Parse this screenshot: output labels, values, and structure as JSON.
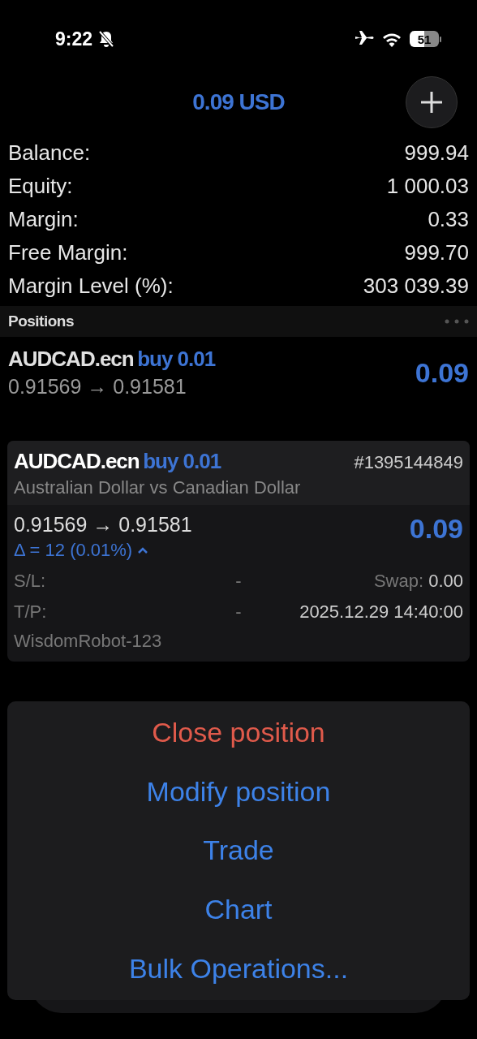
{
  "status_bar": {
    "time": "9:22",
    "battery": "51"
  },
  "header": {
    "title": "0.09 USD"
  },
  "summary": [
    {
      "label": "Balance:",
      "value": "999.94"
    },
    {
      "label": "Equity:",
      "value": "1 000.03"
    },
    {
      "label": "Margin:",
      "value": "0.33"
    },
    {
      "label": "Free Margin:",
      "value": "999.70"
    },
    {
      "label": "Margin Level (%):",
      "value": "303 039.39"
    }
  ],
  "positions": {
    "title": "Positions",
    "items": [
      {
        "symbol": "AUDCAD.ecn",
        "side": "buy 0.01",
        "prices": "0.91569 → 0.91581",
        "profit": "0.09"
      }
    ]
  },
  "detail": {
    "symbol": "AUDCAD.ecn",
    "side": "buy 0.01",
    "ticket": "#1395144849",
    "description": "Australian Dollar vs Canadian Dollar",
    "prices": "0.91569 → 0.91581",
    "profit": "0.09",
    "delta": "Δ = 12 (0.01%)",
    "expanded": true,
    "fields": [
      {
        "left_label": "S/L:",
        "left_value": "-",
        "right_label": "Swap:",
        "right_value": "0.00"
      },
      {
        "left_label": "T/P:",
        "left_value": "-",
        "right_value": "2025.12.29 14:40:00"
      }
    ],
    "comment": "WisdomRobot-123"
  },
  "menu": [
    {
      "label": "Close position",
      "kind": "destructive"
    },
    {
      "label": "Modify position",
      "kind": "default"
    },
    {
      "label": "Trade",
      "kind": "default"
    },
    {
      "label": "Chart",
      "kind": "default"
    },
    {
      "label": "Bulk Operations...",
      "kind": "default"
    }
  ]
}
